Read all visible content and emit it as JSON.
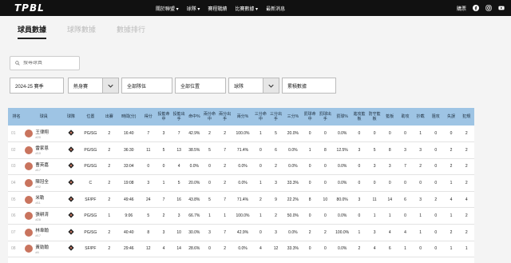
{
  "brand": "TPBL",
  "nav": [
    "關於聯盟 ▾",
    "球隊 ▾",
    "賽程戰績",
    "比賽數據 ▾",
    "最新消息"
  ],
  "top_right": {
    "login": "購票"
  },
  "tabs": [
    "球員數據",
    "球隊數據",
    "數據排行"
  ],
  "search": {
    "placeholder": "搜尋球員"
  },
  "filters": {
    "season": "2024-25 賽季",
    "type": "熱身賽",
    "team": "全部隊伍",
    "position": "全部位置",
    "scope": "球隊",
    "mode": "累積數據"
  },
  "columns": [
    "排名",
    "球員",
    "球隊",
    "位置",
    "出賽",
    "時間(分)",
    "得分",
    "投籃命中",
    "投籃出手",
    "命中%",
    "兩分命中",
    "兩分出手",
    "兩分%",
    "三分命中",
    "三分出手",
    "三分%",
    "罰球命中",
    "罰球出手",
    "罰球%",
    "進攻籃板",
    "防守籃板",
    "籃板",
    "助攻",
    "抄截",
    "阻攻",
    "失誤",
    "犯規"
  ],
  "rows": [
    {
      "rank": "01",
      "name": "王律翔",
      "num": "#20",
      "pos": "PG/SG",
      "stats": [
        "2",
        "16:40",
        "7",
        "3",
        "7",
        "42.9%",
        "2",
        "2",
        "100.0%",
        "1",
        "5",
        "20.0%",
        "0",
        "0",
        "0.0%",
        "0",
        "0",
        "0",
        "0",
        "1",
        "0",
        "0",
        "2"
      ]
    },
    {
      "rank": "02",
      "name": "雷家恩",
      "num": "#10",
      "pos": "PG/SG",
      "stats": [
        "2",
        "36:30",
        "11",
        "5",
        "13",
        "38.5%",
        "5",
        "7",
        "71.4%",
        "0",
        "6",
        "0.0%",
        "1",
        "8",
        "12.5%",
        "3",
        "5",
        "8",
        "3",
        "3",
        "0",
        "2",
        "2"
      ]
    },
    {
      "rank": "03",
      "name": "曹英嘉",
      "num": "#17",
      "pos": "PG/SG",
      "stats": [
        "2",
        "33:04",
        "0",
        "0",
        "4",
        "0.0%",
        "0",
        "2",
        "0.0%",
        "0",
        "2",
        "0.0%",
        "0",
        "0",
        "0.0%",
        "0",
        "3",
        "3",
        "7",
        "2",
        "0",
        "2",
        "2"
      ]
    },
    {
      "rank": "04",
      "name": "陳冠全",
      "num": "#92",
      "pos": "C",
      "stats": [
        "2",
        "19:08",
        "3",
        "1",
        "5",
        "20.0%",
        "0",
        "2",
        "0.0%",
        "1",
        "3",
        "33.3%",
        "0",
        "0",
        "0.0%",
        "0",
        "0",
        "0",
        "0",
        "0",
        "0",
        "1",
        "2"
      ]
    },
    {
      "rank": "05",
      "name": "米勒",
      "num": "#11",
      "pos": "SF/PF",
      "stats": [
        "2",
        "49:46",
        "24",
        "7",
        "16",
        "43.8%",
        "5",
        "7",
        "71.4%",
        "2",
        "9",
        "22.2%",
        "8",
        "10",
        "80.0%",
        "3",
        "11",
        "14",
        "6",
        "3",
        "2",
        "4",
        "4"
      ]
    },
    {
      "rank": "06",
      "name": "張耕淯",
      "num": "#28",
      "pos": "PG/SG",
      "stats": [
        "1",
        "9:06",
        "5",
        "2",
        "3",
        "66.7%",
        "1",
        "1",
        "100.0%",
        "1",
        "2",
        "50.0%",
        "0",
        "0",
        "0.0%",
        "0",
        "1",
        "1",
        "0",
        "1",
        "0",
        "1",
        "2"
      ]
    },
    {
      "rank": "07",
      "name": "林韋翰",
      "num": "#17",
      "pos": "PG/SG",
      "stats": [
        "2",
        "40:40",
        "8",
        "3",
        "10",
        "30.0%",
        "3",
        "7",
        "42.9%",
        "0",
        "3",
        "0.0%",
        "2",
        "2",
        "100.0%",
        "1",
        "3",
        "4",
        "4",
        "1",
        "0",
        "2",
        "2"
      ]
    },
    {
      "rank": "08",
      "name": "黃勁翰",
      "num": "#4",
      "pos": "SF/PF",
      "stats": [
        "2",
        "29:46",
        "12",
        "4",
        "14",
        "28.6%",
        "0",
        "2",
        "0.0%",
        "4",
        "12",
        "33.3%",
        "0",
        "0",
        "0.0%",
        "2",
        "4",
        "6",
        "1",
        "0",
        "0",
        "1",
        "1"
      ]
    }
  ]
}
